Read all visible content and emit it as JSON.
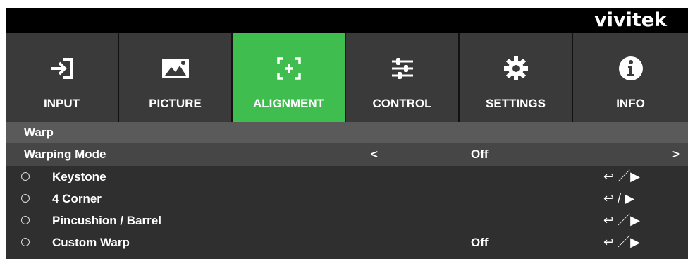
{
  "brand": "vivitek",
  "tabs": [
    {
      "label": "INPUT",
      "icon": "input-icon"
    },
    {
      "label": "PICTURE",
      "icon": "picture-icon"
    },
    {
      "label": "ALIGNMENT",
      "icon": "alignment-icon",
      "active": true
    },
    {
      "label": "CONTROL",
      "icon": "control-sliders-icon"
    },
    {
      "label": "SETTINGS",
      "icon": "gear-icon"
    },
    {
      "label": "INFO",
      "icon": "info-icon"
    }
  ],
  "section_title": "Warp",
  "warping_mode": {
    "label": "Warping Mode",
    "left_arrow": "<",
    "value": "Off",
    "right_arrow": ">"
  },
  "items": [
    {
      "label": "Keystone",
      "value": "",
      "enter": "↩ ／▶"
    },
    {
      "label": "4 Corner",
      "value": "",
      "enter": "↩ / ▶"
    },
    {
      "label": "Pincushion / Barrel",
      "value": "",
      "enter": "↩ ／▶"
    },
    {
      "label": "Custom Warp",
      "value": "Off",
      "enter": "↩ ／▶"
    }
  ],
  "colors": {
    "active_tab": "#3fbe4f",
    "tab_bg": "#3a3a3a",
    "section_bg": "#5a5a5a",
    "menu_bg": "#2f2f2f"
  }
}
